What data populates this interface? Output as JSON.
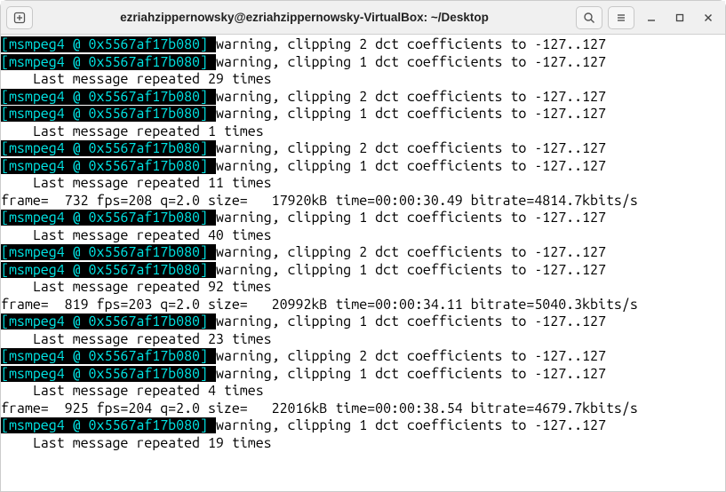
{
  "titlebar": {
    "title": "ezriahzippernowsky@ezriahzippernowsky-VirtualBox: ~/Desktop"
  },
  "tag": "[msmpeg4 @ 0x5567af17b080]",
  "inv": " ",
  "lines": [
    {
      "t": "tag_warn",
      "n": 2
    },
    {
      "t": "tag_warn",
      "n": 1
    },
    {
      "t": "repeat",
      "n": 29
    },
    {
      "t": "tag_warn",
      "n": 2
    },
    {
      "t": "tag_warn",
      "n": 1
    },
    {
      "t": "repeat",
      "n": 1
    },
    {
      "t": "tag_warn",
      "n": 2
    },
    {
      "t": "tag_warn",
      "n": 1
    },
    {
      "t": "repeat",
      "n": 11
    },
    {
      "t": "frame",
      "text": "frame=  732 fps=208 q=2.0 size=   17920kB time=00:00:30.49 bitrate=4814.7kbits/s"
    },
    {
      "t": "tag_warn",
      "n": 1
    },
    {
      "t": "repeat",
      "n": 40
    },
    {
      "t": "tag_warn",
      "n": 2
    },
    {
      "t": "tag_warn",
      "n": 1
    },
    {
      "t": "repeat",
      "n": 92
    },
    {
      "t": "frame",
      "text": "frame=  819 fps=203 q=2.0 size=   20992kB time=00:00:34.11 bitrate=5040.3kbits/s"
    },
    {
      "t": "tag_warn",
      "n": 1
    },
    {
      "t": "repeat",
      "n": 23
    },
    {
      "t": "tag_warn",
      "n": 2
    },
    {
      "t": "tag_warn",
      "n": 1
    },
    {
      "t": "repeat",
      "n": 4
    },
    {
      "t": "frame",
      "text": "frame=  925 fps=204 q=2.0 size=   22016kB time=00:00:38.54 bitrate=4679.7kbits/s"
    },
    {
      "t": "tag_warn",
      "n": 1
    },
    {
      "t": "repeat",
      "n": 19
    }
  ],
  "warnTemplate": "warning, clipping {N} dct coefficients to -127..127",
  "repeatTemplate": "    Last message repeated {N} times"
}
